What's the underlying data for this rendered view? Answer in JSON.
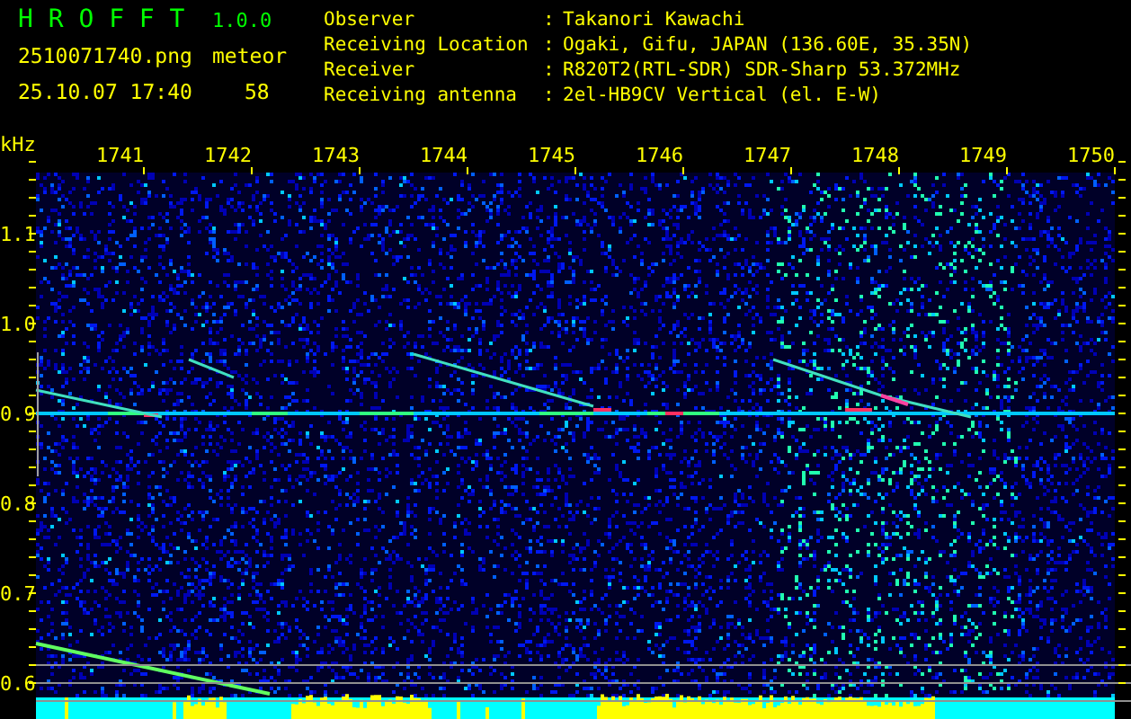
{
  "header": {
    "app_name": "H R O F F T",
    "version": "1.0.0",
    "filename": "2510071740.png",
    "datetime": "25.10.07 17:40",
    "type_label": "meteor",
    "count": "58"
  },
  "station": [
    {
      "label": "Observer",
      "sep": ":",
      "value": "Takanori Kawachi"
    },
    {
      "label": "Receiving Location",
      "sep": ":",
      "value": "Ogaki, Gifu, JAPAN (136.60E, 35.35N)"
    },
    {
      "label": "Receiver",
      "sep": ":",
      "value": "R820T2(RTL-SDR) SDR-Sharp 53.372MHz"
    },
    {
      "label": "Receiving antenna",
      "sep": ":",
      "value": "2el-HB9CV Vertical (el. E-W)"
    }
  ],
  "x_axis": {
    "ticks": [
      "1741",
      "1742",
      "1743",
      "1744",
      "1745",
      "1746",
      "1747",
      "1748",
      "1749",
      "1750"
    ]
  },
  "y_axis": {
    "unit": "kHz",
    "ticks": [
      "1.1",
      "1.0",
      "0.9",
      "0.8",
      "0.7",
      "0.6"
    ]
  }
}
